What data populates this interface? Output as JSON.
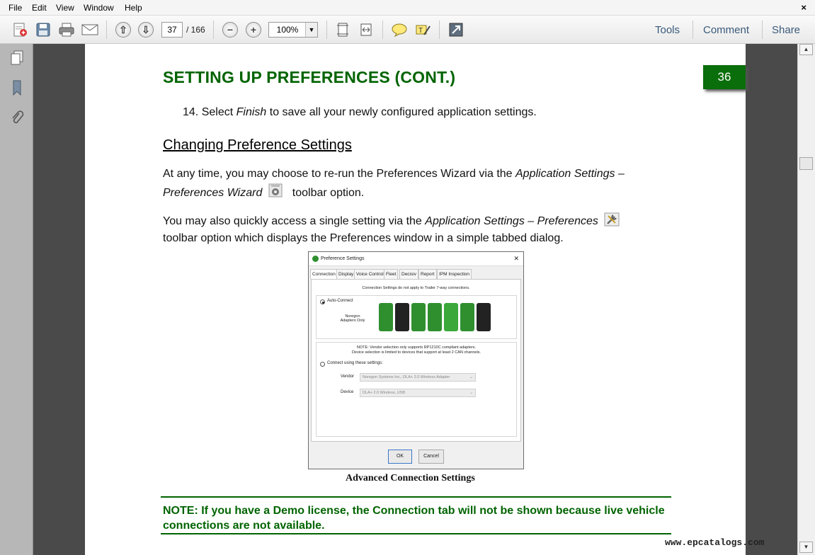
{
  "menu": {
    "items": [
      "File",
      "Edit",
      "View",
      "Window",
      "Help"
    ],
    "close_glyph": "×"
  },
  "toolbar": {
    "page_current": "37",
    "page_total": "/ 166",
    "zoom": "100%",
    "links": [
      "Tools",
      "Comment",
      "Share"
    ],
    "icons": [
      "create-pdf-icon",
      "save-icon",
      "print-icon",
      "email-icon",
      "page-up-icon",
      "page-down-icon",
      "zoom-out-icon",
      "zoom-in-icon",
      "fit-page-icon",
      "fit-width-icon",
      "comment-icon",
      "highlight-icon",
      "fullscreen-icon"
    ]
  },
  "navpane": {
    "icons": [
      "pages-icon",
      "bookmarks-icon",
      "attachments-icon"
    ]
  },
  "document": {
    "heading": "SETTING UP PREFERENCES (CONT.)",
    "page_badge": "36",
    "step_number": "14. Select ",
    "step_em": "Finish",
    "step_rest": " to save all your newly configured application settings.",
    "subheading": "Changing Preference Settings",
    "para1_a": "At any time, you may choose to re-run the Preferences Wizard via the ",
    "para1_em": "Application Settings – Preferences Wizard",
    "para1_b": " toolbar option.",
    "para2_a": "You may also quickly access a single setting via the ",
    "para2_em": "Application Settings – Preferences",
    "para2_b": "toolbar option which displays the Preferences window in a simple tabbed dialog.",
    "caption": "Advanced Connection Settings",
    "note": "NOTE: If you have a Demo license, the Connection tab will not be shown because live vehicle connections are not available."
  },
  "dialog": {
    "title": "Preference Settings",
    "close": "✕",
    "tabs": [
      "Connection",
      "Display",
      "Voice Control",
      "Fleet",
      "Decisiv",
      "Report",
      "IPM Inspection"
    ],
    "info": "Connection Settings do not apply to Trailer 7-way connections.",
    "auto_connect": "Auto-Connect",
    "noregon_label_1": "Noregon",
    "noregon_label_2": "Adapters Only",
    "note_line1": "NOTE: Vendor selection only supports RP1210C compliant adapters.",
    "note_line2": "Device selection is limited to devices that support at least 2 CAN channels.",
    "connect_manual": "Connect using these settings:",
    "vendor_label": "Vendor",
    "vendor_value": "Noregon Systems Inc., DLA+ 2.0 Wireless Adapter",
    "device_label": "Device",
    "device_value": "DLA+ 2.0 Wireless, USB",
    "ok": "OK",
    "cancel": "Cancel",
    "adapter_colors": [
      "#2f8f2f",
      "#222222",
      "#2f8f2f",
      "#2f8f2f",
      "#3aa83a",
      "#2f8f2f",
      "#222222"
    ]
  },
  "watermark": "www.epcatalogs.com"
}
